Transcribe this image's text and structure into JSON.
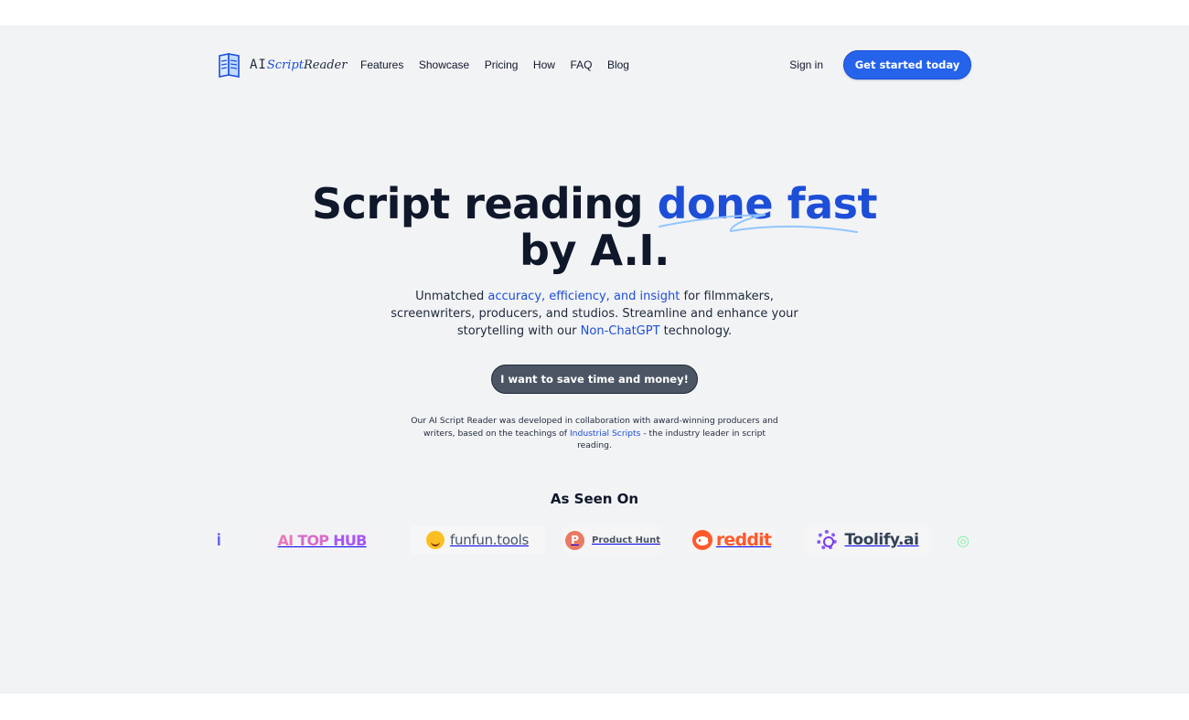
{
  "brand": {
    "name_ai": "AI",
    "name_script": "Script",
    "name_reader": "Reader",
    "accent_color": "#2563eb"
  },
  "nav": {
    "links": [
      "Features",
      "Showcase",
      "Pricing",
      "How",
      "FAQ",
      "Blog"
    ],
    "sign_in": "Sign in",
    "cta": "Get started today"
  },
  "hero": {
    "title_part1": "Script reading ",
    "title_highlight": "done fast",
    "title_part2": "by A.I.",
    "subtitle_part1": "Unmatched ",
    "subtitle_highlight1": "accuracy, efficiency, and insight",
    "subtitle_part2": " for filmmakers, screenwriters, producers, and studios. Streamline and enhance your storytelling with our ",
    "subtitle_highlight2": "Non-ChatGPT",
    "subtitle_part3": " technology.",
    "cta": "I want to save time and money!",
    "collab_part1": "Our AI Script Reader was developed in collaboration with award-winning producers and writers, based on the teachings of ",
    "collab_link": "Industrial Scripts",
    "collab_part2": " - the industry leader in script reading."
  },
  "as_seen_on": {
    "title": "As Seen On",
    "logos": {
      "aitophub_ai": "AI",
      "aitophub_top": "TOP",
      "aitophub_hub": "HUB",
      "funfun": "funfun.tools",
      "producthunt_letter": "P",
      "producthunt": "Product Hunt",
      "reddit": "reddit",
      "toolify": "Toolify.ai"
    }
  }
}
